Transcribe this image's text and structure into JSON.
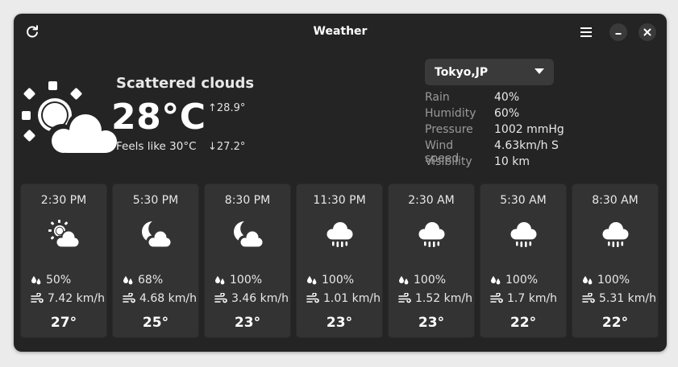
{
  "header": {
    "title": "Weather",
    "refresh_icon": "refresh-icon",
    "menu_icon": "hamburger-menu-icon",
    "minimize_icon": "minimize-icon",
    "close_icon": "close-icon"
  },
  "current": {
    "icon": "partly-cloudy-day-icon",
    "description": "Scattered clouds",
    "temperature": "28°C",
    "high": "28.9°",
    "low": "27.2°",
    "feels_like": "Feels like 30°C"
  },
  "location": {
    "value": "Tokyo,JP",
    "dropdown_icon": "caret-down-icon"
  },
  "details": [
    {
      "label": "Rain",
      "value": "40%"
    },
    {
      "label": "Humidity",
      "value": "60%"
    },
    {
      "label": "Pressure",
      "value": "1002 mmHg"
    },
    {
      "label": "Wind speed",
      "value": "4.63km/h S"
    },
    {
      "label": "Visibility",
      "value": "10 km"
    }
  ],
  "forecast": [
    {
      "time": "2:30 PM",
      "icon": "partly-cloudy-day-icon",
      "rain": "50%",
      "wind": "7.42 km/h",
      "temp": "27°"
    },
    {
      "time": "5:30 PM",
      "icon": "partly-cloudy-night-icon",
      "rain": "68%",
      "wind": "4.68 km/h",
      "temp": "25°"
    },
    {
      "time": "8:30 PM",
      "icon": "partly-cloudy-night-icon",
      "rain": "100%",
      "wind": "3.46 km/h",
      "temp": "23°"
    },
    {
      "time": "11:30 PM",
      "icon": "rain-icon",
      "rain": "100%",
      "wind": "1.01 km/h",
      "temp": "23°"
    },
    {
      "time": "2:30 AM",
      "icon": "rain-icon",
      "rain": "100%",
      "wind": "1.52 km/h",
      "temp": "23°"
    },
    {
      "time": "5:30 AM",
      "icon": "rain-icon",
      "rain": "100%",
      "wind": "1.7 km/h",
      "temp": "22°"
    },
    {
      "time": "8:30 AM",
      "icon": "rain-icon",
      "rain": "100%",
      "wind": "5.31 km/h",
      "temp": "22°"
    }
  ],
  "colors": {
    "window_bg": "#242424",
    "card_bg": "#333333",
    "button_bg": "#3a3a3a",
    "text": "#ffffff",
    "muted_text": "#9a9a9a"
  }
}
